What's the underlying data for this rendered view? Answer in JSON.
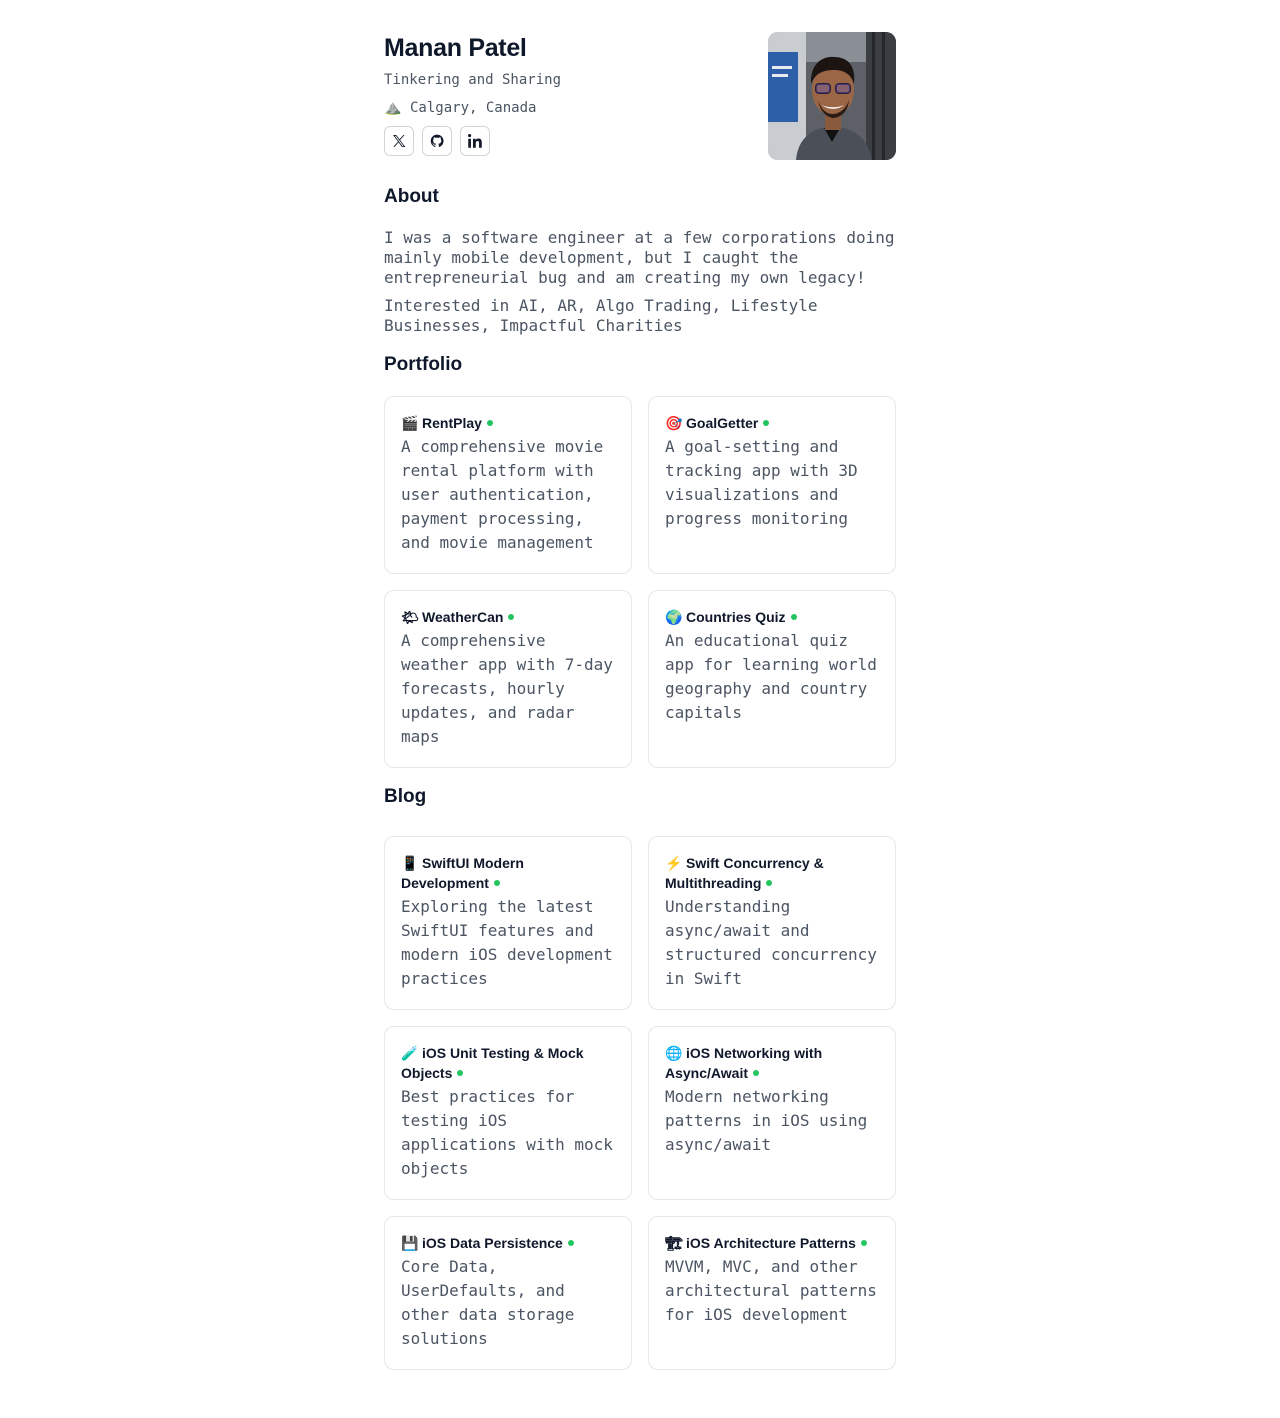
{
  "profile": {
    "name": "Manan Patel",
    "tagline": "Tinkering and Sharing",
    "location_icon": "mountain-icon",
    "location": "Calgary, Canada",
    "socials": [
      {
        "icon": "x-twitter-icon"
      },
      {
        "icon": "github-icon"
      },
      {
        "icon": "linkedin-icon"
      }
    ]
  },
  "about": {
    "heading": "About",
    "paragraphs": [
      "I was a software engineer at a few corporations doing mainly mobile development, but I caught the entrepreneurial bug and am creating my own legacy!",
      "Interested in AI, AR, Algo Trading, Lifestyle Businesses, Impactful Charities"
    ]
  },
  "portfolio": {
    "heading": "Portfolio",
    "items": [
      {
        "icon": "🎬",
        "title": "RentPlay",
        "desc": "A comprehensive movie rental platform with user authentication, payment processing, and movie management"
      },
      {
        "icon": "🎯",
        "title": "GoalGetter",
        "desc": "A goal-setting and tracking app with 3D visualizations and progress monitoring"
      },
      {
        "icon": "🌤",
        "title": "WeatherCan",
        "desc": "A comprehensive weather app with 7-day forecasts, hourly updates, and radar maps"
      },
      {
        "icon": "🌍",
        "title": "Countries Quiz",
        "desc": "An educational quiz app for learning world geography and country capitals"
      }
    ]
  },
  "blog": {
    "heading": "Blog",
    "items": [
      {
        "icon": "📱",
        "title": "SwiftUI Modern Development",
        "desc": "Exploring the latest SwiftUI features and modern iOS development practices"
      },
      {
        "icon": "⚡",
        "title": "Swift Concurrency & Multithreading",
        "desc": "Understanding async/await and structured concurrency in Swift"
      },
      {
        "icon": "🧪",
        "title": "iOS Unit Testing & Mock Objects",
        "desc": "Best practices for testing iOS applications with mock objects"
      },
      {
        "icon": "🌐",
        "title": "iOS Networking with Async/Await",
        "desc": "Modern networking patterns in iOS using async/await"
      },
      {
        "icon": "💾",
        "title": "iOS Data Persistence",
        "desc": "Core Data, UserDefaults, and other data storage solutions"
      },
      {
        "icon": "🏗",
        "title": "iOS Architecture Patterns",
        "desc": "MVVM, MVC, and other architectural patterns for iOS development"
      }
    ]
  },
  "colors": {
    "status_dot": "#22c55e",
    "text_primary": "#0f172a",
    "text_secondary": "#4b5563",
    "card_border": "#e5e7eb"
  }
}
